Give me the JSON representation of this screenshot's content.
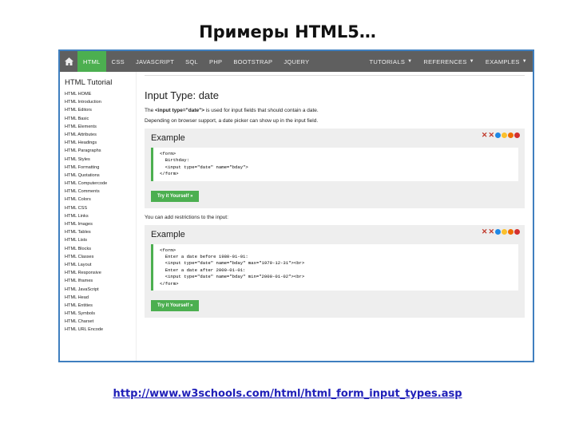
{
  "slide": {
    "title": "Примеры HTML5…",
    "url": "http://www.w3schools.com/html/html_form_input_types.asp"
  },
  "topnav": {
    "items": [
      "HTML",
      "CSS",
      "JAVASCRIPT",
      "SQL",
      "PHP",
      "BOOTSTRAP",
      "JQUERY"
    ],
    "right": [
      "TUTORIALS",
      "REFERENCES",
      "EXAMPLES"
    ],
    "active_color": "#4caf50",
    "bg_color": "#5f5f5f"
  },
  "sidebar": {
    "title": "HTML Tutorial",
    "items": [
      "HTML HOME",
      "HTML Introduction",
      "HTML Editors",
      "HTML Basic",
      "HTML Elements",
      "HTML Attributes",
      "HTML Headings",
      "HTML Paragraphs",
      "HTML Styles",
      "HTML Formatting",
      "HTML Quotations",
      "HTML Computercode",
      "HTML Comments",
      "HTML Colors",
      "HTML CSS",
      "HTML Links",
      "HTML Images",
      "HTML Tables",
      "HTML Lists",
      "HTML Blocks",
      "HTML Classes",
      "HTML Layout",
      "HTML Responsive",
      "HTML Iframes",
      "HTML JavaScript",
      "HTML Head",
      "HTML Entities",
      "HTML Symbols",
      "HTML Charset",
      "HTML URL Encode"
    ]
  },
  "main": {
    "heading": "Input Type: date",
    "desc_pre": "The ",
    "desc_code": "<input type=\"date\">",
    "desc_post": " is used for input fields that should contain a date.",
    "support_line": "Depending on browser support, a date picker can show up in the input field.",
    "restrict_line": "You can add restrictions to the input:",
    "example1": {
      "title": "Example",
      "lines": [
        "<form>",
        "  Birthday:",
        "  <input type=\"date\" name=\"bday\">",
        "</form>"
      ],
      "button": "Try it Yourself »"
    },
    "example2": {
      "title": "Example",
      "lines": [
        "<form>",
        "  Enter a date before 1980-01-01:",
        "  <input type=\"date\" name=\"bday\" max=\"1979-12-31\"><br>",
        "  Enter a date after 2000-01-01:",
        "  <input type=\"date\" name=\"bday\" min=\"2000-01-02\"><br>",
        "</form>"
      ],
      "button": "Try it Yourself »"
    },
    "browser_icons": [
      "close-x-icon",
      "ie-icon",
      "chrome-icon",
      "firefox-icon",
      "opera-icon"
    ]
  }
}
